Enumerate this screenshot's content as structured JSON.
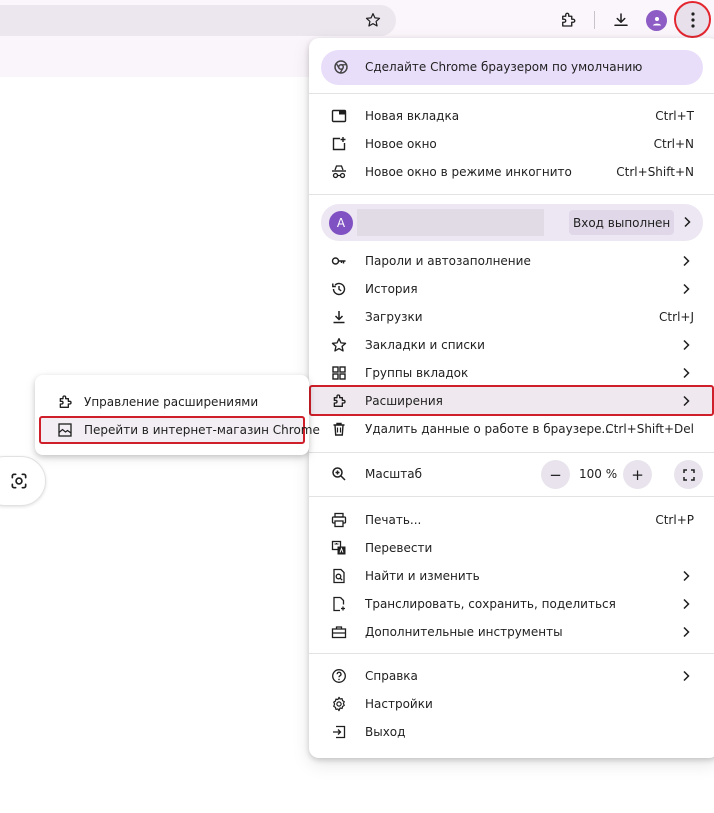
{
  "toolbar": {
    "icons": [
      "star-icon",
      "extensions-puzzle-icon",
      "download-icon",
      "profile-avatar-icon",
      "more-vert-icon"
    ]
  },
  "menu": {
    "promo_label": "Сделайте Chrome браузером по умолчанию",
    "new_tab": {
      "label": "Новая вкладка",
      "shortcut": "Ctrl+T"
    },
    "new_window": {
      "label": "Новое окно",
      "shortcut": "Ctrl+N"
    },
    "incognito": {
      "label": "Новое окно в режиме инкогнито",
      "shortcut": "Ctrl+Shift+N"
    },
    "profile": {
      "initial": "A",
      "status": "Вход выполнен"
    },
    "passwords": {
      "label": "Пароли и автозаполнение"
    },
    "history": {
      "label": "История"
    },
    "downloads": {
      "label": "Загрузки",
      "shortcut": "Ctrl+J"
    },
    "bookmarks": {
      "label": "Закладки и списки"
    },
    "tab_groups": {
      "label": "Группы вкладок"
    },
    "extensions": {
      "label": "Расширения"
    },
    "clear_data": {
      "label": "Удалить данные о работе в браузере...",
      "shortcut": "Ctrl+Shift+Del"
    },
    "zoom": {
      "label": "Масштаб",
      "minus": "−",
      "value": "100 %",
      "plus": "+"
    },
    "print": {
      "label": "Печать...",
      "shortcut": "Ctrl+P"
    },
    "translate": {
      "label": "Перевести"
    },
    "find_edit": {
      "label": "Найти и изменить"
    },
    "cast_save_share": {
      "label": "Транслировать, сохранить, поделиться"
    },
    "more_tools": {
      "label": "Дополнительные инструменты"
    },
    "help": {
      "label": "Справка"
    },
    "settings": {
      "label": "Настройки"
    },
    "exit": {
      "label": "Выход"
    }
  },
  "submenu": {
    "manage_extensions": "Управление расширениями",
    "web_store": "Перейти в интернет-магазин Chrome"
  },
  "colors": {
    "accent_highlight": "#cf1f2a",
    "promo_bg": "#e9defa",
    "profile_avatar": "#8051c2"
  }
}
